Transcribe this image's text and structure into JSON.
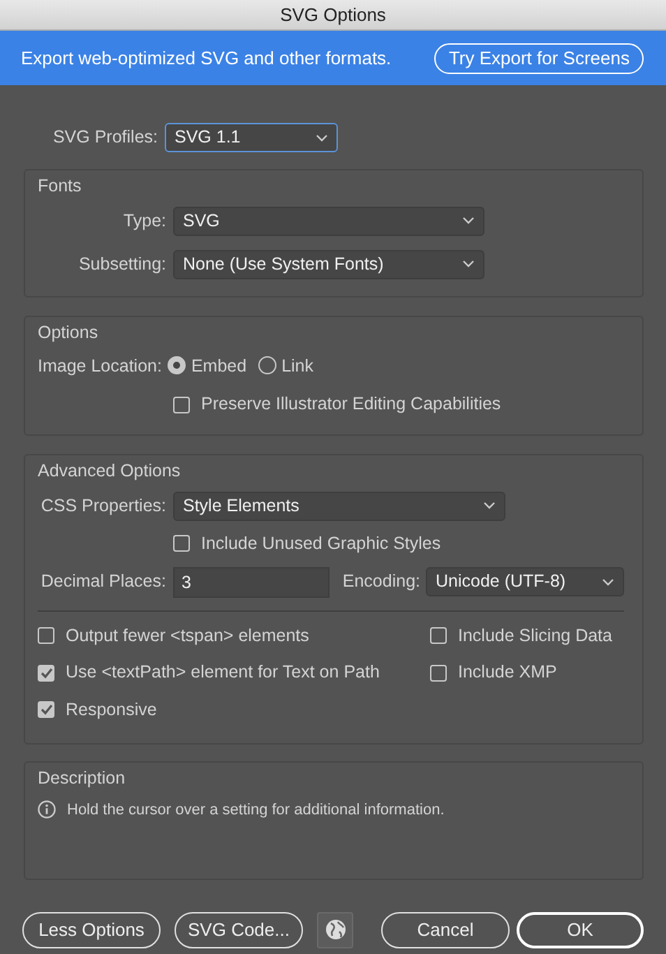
{
  "window": {
    "title": "SVG Options"
  },
  "banner": {
    "text": "Export web-optimized SVG and other formats.",
    "button": "Try Export for Screens"
  },
  "profile": {
    "label": "SVG Profiles:",
    "value": "SVG 1.1"
  },
  "fonts": {
    "title": "Fonts",
    "fields": [
      {
        "label": "Type:",
        "value": "SVG"
      },
      {
        "label": "Subsetting:",
        "value": "None (Use System Fonts)"
      }
    ]
  },
  "options": {
    "title": "Options",
    "image_location": {
      "label": "Image Location:",
      "choices": [
        {
          "label": "Embed",
          "selected": true
        },
        {
          "label": "Link",
          "selected": false
        }
      ]
    },
    "checkboxes": [
      {
        "label": "Preserve Illustrator Editing Capabilities",
        "checked": false
      }
    ]
  },
  "advanced": {
    "title": "Advanced Options",
    "css_properties": {
      "label": "CSS Properties:",
      "value": "Style Elements"
    },
    "unused_styles": {
      "label": "Include Unused Graphic Styles",
      "checked": false
    },
    "decimal_places": {
      "label": "Decimal Places:",
      "value": "3"
    },
    "encoding": {
      "label": "Encoding:",
      "value": "Unicode (UTF-8)"
    },
    "left_checkboxes": [
      {
        "label": "Output fewer <tspan> elements",
        "checked": false
      },
      {
        "label": "Use <textPath> element for Text on Path",
        "checked": true
      },
      {
        "label": "Responsive",
        "checked": true
      }
    ],
    "right_checkboxes": [
      {
        "label": "Include Slicing Data",
        "checked": false
      },
      {
        "label": "Include XMP",
        "checked": false
      }
    ]
  },
  "description": {
    "title": "Description",
    "text": "Hold the cursor over a setting for additional information."
  },
  "buttons": [
    {
      "label": "Less Options",
      "kind": "normal"
    },
    {
      "label": "SVG Code...",
      "kind": "normal"
    },
    {
      "kind": "globe"
    },
    {
      "label": "Cancel",
      "kind": "normal"
    },
    {
      "label": "OK",
      "kind": "default"
    }
  ]
}
